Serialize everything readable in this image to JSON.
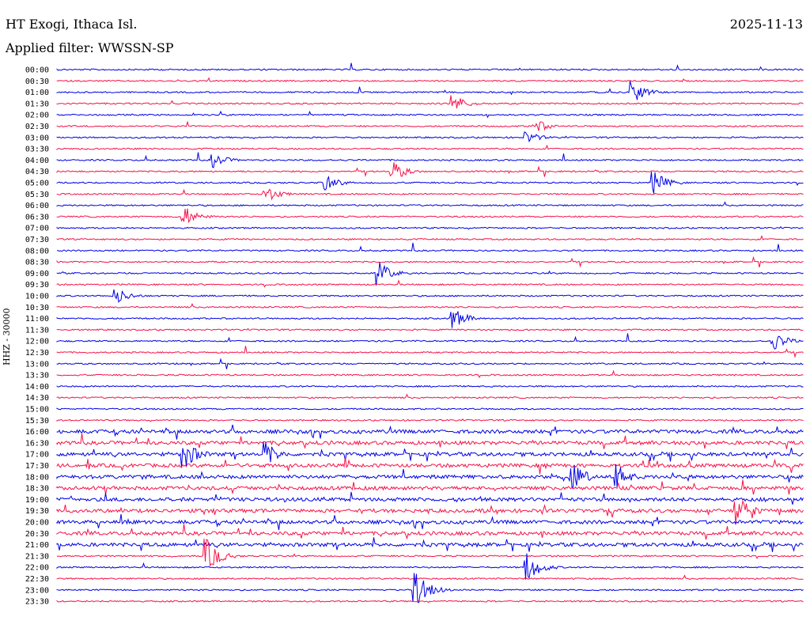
{
  "header": {
    "station": "HT Exogi, Ithaca Isl.",
    "date": "2025-11-13",
    "filter_label": "Applied filter: WWSSN-SP",
    "channel_label": "HHZ - 30000"
  },
  "chart_data": {
    "type": "line",
    "title": "HT Exogi, Ithaca Isl.",
    "subtitle": "Applied filter: WWSSN-SP",
    "ylabel": "HHZ - 30000",
    "row_labels": [
      "00:00",
      "00:30",
      "01:00",
      "01:30",
      "02:00",
      "02:30",
      "03:00",
      "03:30",
      "04:00",
      "04:30",
      "05:00",
      "05:30",
      "06:00",
      "06:30",
      "07:00",
      "07:30",
      "08:00",
      "08:30",
      "09:00",
      "09:30",
      "10:00",
      "10:30",
      "11:00",
      "11:30",
      "12:00",
      "12:30",
      "13:00",
      "13:30",
      "14:00",
      "14:30",
      "15:00",
      "15:30",
      "16:00",
      "16:30",
      "17:00",
      "17:30",
      "18:00",
      "18:30",
      "19:00",
      "19:30",
      "20:00",
      "20:30",
      "21:00",
      "21:30",
      "22:00",
      "22:30",
      "23:00",
      "23:30"
    ],
    "colors": [
      "#0000e6",
      "#f5124a"
    ],
    "grid": false,
    "events": [
      {
        "row": 2,
        "x": 0.77,
        "amp": 1.0
      },
      {
        "row": 3,
        "x": 0.53,
        "amp": 0.8
      },
      {
        "row": 5,
        "x": 0.64,
        "amp": 0.6
      },
      {
        "row": 6,
        "x": 0.63,
        "amp": 0.5
      },
      {
        "row": 8,
        "x": 0.21,
        "amp": 0.6
      },
      {
        "row": 9,
        "x": 0.45,
        "amp": 0.8
      },
      {
        "row": 10,
        "x": 0.36,
        "amp": 0.7
      },
      {
        "row": 10,
        "x": 0.8,
        "amp": 0.9
      },
      {
        "row": 11,
        "x": 0.28,
        "amp": 0.7
      },
      {
        "row": 13,
        "x": 0.17,
        "amp": 0.9
      },
      {
        "row": 18,
        "x": 0.43,
        "amp": 1.0
      },
      {
        "row": 20,
        "x": 0.08,
        "amp": 0.7
      },
      {
        "row": 22,
        "x": 0.53,
        "amp": 0.9
      },
      {
        "row": 24,
        "x": 0.96,
        "amp": 0.8
      },
      {
        "row": 34,
        "x": 0.17,
        "amp": 1.3
      },
      {
        "row": 34,
        "x": 0.28,
        "amp": 1.0
      },
      {
        "row": 36,
        "x": 0.69,
        "amp": 1.2
      },
      {
        "row": 36,
        "x": 0.75,
        "amp": 1.0
      },
      {
        "row": 39,
        "x": 0.91,
        "amp": 1.3
      },
      {
        "row": 43,
        "x": 0.2,
        "amp": 1.4
      },
      {
        "row": 44,
        "x": 0.63,
        "amp": 1.2
      },
      {
        "row": 46,
        "x": 0.48,
        "amp": 1.5
      }
    ],
    "noisy_rows": [
      32,
      33,
      34,
      35,
      36,
      37,
      38,
      39,
      40,
      41,
      42
    ]
  }
}
